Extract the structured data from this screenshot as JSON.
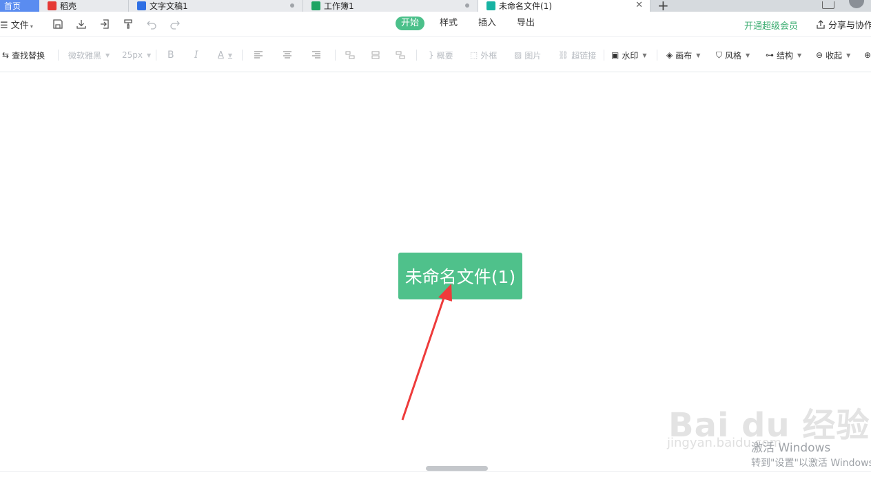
{
  "tabs": [
    {
      "label": "首页",
      "icon": "home-tab",
      "color": "#5a8cf0"
    },
    {
      "label": "稻壳",
      "icon": "docer-icon",
      "color": "#e53935"
    },
    {
      "label": "文字文稿1",
      "icon": "writer-icon",
      "color": "#2f6fe4"
    },
    {
      "label": "工作簿1",
      "icon": "sheet-icon",
      "color": "#1fa463"
    },
    {
      "label": "未命名文件(1)",
      "icon": "mindmap-icon",
      "color": "#17b3a3"
    }
  ],
  "menu": {
    "file": "文件",
    "tabs": [
      "开始",
      "样式",
      "插入",
      "导出"
    ],
    "active_tab": "开始",
    "vip": "开通超级会员",
    "share": "分享与协作"
  },
  "toolbar": {
    "find_replace": "查找替换",
    "font": "微软雅黑",
    "font_size": "25px",
    "bold": "B",
    "italic": "I",
    "font_color": "A",
    "summary": "概要",
    "frame": "外框",
    "image": "图片",
    "hyperlink": "超链接",
    "watermark": "水印",
    "canvas": "画布",
    "style": "风格",
    "structure": "结构",
    "collapse": "收起"
  },
  "canvas": {
    "central_topic": "未命名文件(1)"
  },
  "watermark": {
    "baidu": "Bai du 经验",
    "jingyan": "jingyan.baidu.com"
  },
  "activation": {
    "title": "激活 Windows",
    "subtitle": "转到\"设置\"以激活 Windows"
  },
  "colors": {
    "accent": "#4bc08a",
    "topic_bg": "#4fc18b",
    "arrow": "#ee3b3b",
    "vip": "#3fae73"
  }
}
